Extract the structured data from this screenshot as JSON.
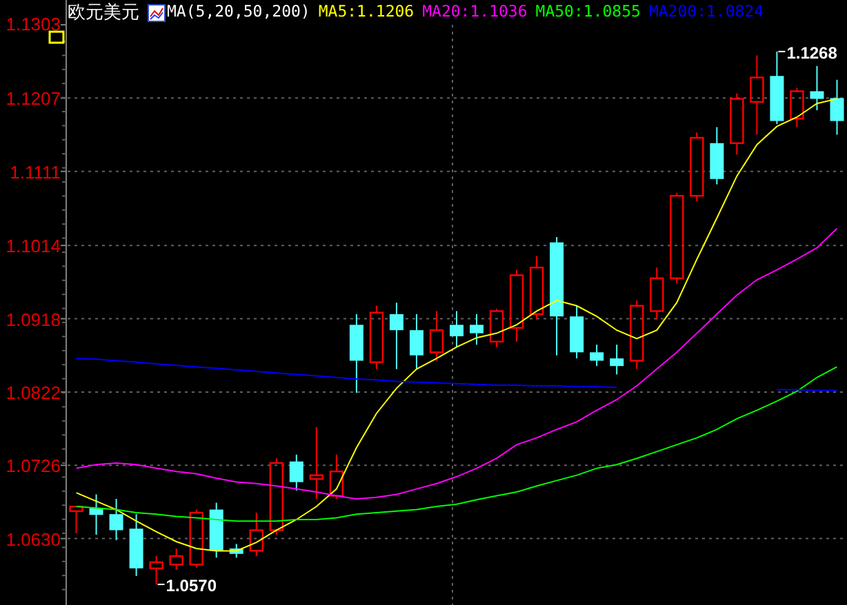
{
  "header": {
    "title": "欧元美元",
    "indicator": "MA(5,20,50,200)",
    "readings": [
      {
        "value": ":1.1206",
        "color": "#ffff00"
      },
      {
        "value": ":1.1036",
        "color": "#ff00ff"
      },
      {
        "value": ":1.0855",
        "color": "#00ff00"
      },
      {
        "value": ":1.0824",
        "color": "#0000ff"
      }
    ]
  },
  "chart": {
    "chart_data": {
      "type": "candlestick",
      "grid": true,
      "ylim": [
        1.0543,
        1.1303
      ],
      "yticks": [
        {
          "value": 1.1303,
          "label": "1.1303"
        },
        {
          "value": 1.1207,
          "label": "1.1207"
        },
        {
          "value": 1.1111,
          "label": "1.1111"
        },
        {
          "value": 1.1014,
          "label": "1.1014"
        },
        {
          "value": 1.0918,
          "label": "1.0918"
        },
        {
          "value": 1.0822,
          "label": "1.0822"
        },
        {
          "value": 1.0726,
          "label": "1.0726"
        },
        {
          "value": 1.063,
          "label": "1.0630"
        }
      ],
      "ohlc": [
        [
          1.0666,
          1.0672,
          1.0637,
          1.0672
        ],
        [
          1.067,
          1.0688,
          1.0635,
          1.0661
        ],
        [
          1.0662,
          1.0682,
          1.0628,
          1.0641
        ],
        [
          1.0643,
          1.0662,
          1.0581,
          1.0591
        ],
        [
          1.0591,
          1.0607,
          1.057,
          1.0599
        ],
        [
          1.0596,
          1.0617,
          1.0589,
          1.0607
        ],
        [
          1.0596,
          1.0668,
          1.0592,
          1.0664
        ],
        [
          1.0668,
          1.0677,
          1.0605,
          1.0614
        ],
        [
          1.0617,
          1.0623,
          1.0605,
          1.061
        ],
        [
          1.0614,
          1.0664,
          1.0607,
          1.0641
        ],
        [
          1.0641,
          1.0735,
          1.0635,
          1.0729
        ],
        [
          1.0731,
          1.074,
          1.0693,
          1.0704
        ],
        [
          1.0708,
          1.0776,
          1.0682,
          1.0713
        ],
        [
          1.0686,
          1.074,
          1.0682,
          1.0718
        ],
        [
          1.091,
          1.0924,
          1.0821,
          1.0863
        ],
        [
          1.0861,
          1.0935,
          1.0852,
          1.0926
        ],
        [
          1.0924,
          1.0939,
          1.0852,
          1.0903
        ],
        [
          1.0903,
          1.0924,
          1.0852,
          1.087
        ],
        [
          1.0874,
          1.0928,
          1.0863,
          1.0903
        ],
        [
          1.091,
          1.0928,
          1.0881,
          1.0895
        ],
        [
          1.091,
          1.0924,
          1.0884,
          1.0899
        ],
        [
          1.0888,
          1.0931,
          1.0881,
          1.0928
        ],
        [
          1.0906,
          1.0982,
          1.0888,
          1.0975
        ],
        [
          1.0924,
          1.1,
          1.0917,
          1.0985
        ],
        [
          1.1018,
          1.1025,
          1.087,
          1.0921
        ],
        [
          1.0921,
          1.0935,
          1.0866,
          1.0874
        ],
        [
          1.0874,
          1.0884,
          1.0856,
          1.0863
        ],
        [
          1.0866,
          1.0884,
          1.0845,
          1.0856
        ],
        [
          1.0863,
          1.0942,
          1.0852,
          1.0935
        ],
        [
          1.0928,
          1.0985,
          1.0917,
          1.0971
        ],
        [
          1.0971,
          1.1083,
          1.0964,
          1.1079
        ],
        [
          1.1079,
          1.1162,
          1.1072,
          1.1155
        ],
        [
          1.1148,
          1.1169,
          1.1094,
          1.1101
        ],
        [
          1.1148,
          1.1213,
          1.1133,
          1.1206
        ],
        [
          1.1202,
          1.1263,
          1.1159,
          1.1234
        ],
        [
          1.1236,
          1.1268,
          1.1173,
          1.1177
        ],
        [
          1.118,
          1.122,
          1.1169,
          1.1216
        ],
        [
          1.1216,
          1.1249,
          1.1191,
          1.1206
        ],
        [
          1.1207,
          1.1231,
          1.1159,
          1.1177
        ]
      ],
      "series": [
        {
          "name": "MA5",
          "type": "line",
          "color": "#ffff00",
          "values": [
            1.069,
            1.0679,
            1.0668,
            1.0653,
            1.0639,
            1.0626,
            1.0617,
            1.0614,
            1.0614,
            1.0625,
            1.0641,
            1.0655,
            1.0672,
            1.0695,
            1.0749,
            1.0794,
            1.0827,
            1.0852,
            1.0866,
            1.0881,
            1.0893,
            1.0899,
            1.091,
            1.0928,
            1.0942,
            1.0935,
            1.0921,
            1.0903,
            1.0892,
            1.0903,
            1.0939,
            1.0996,
            1.105,
            1.1105,
            1.1146,
            1.117,
            1.1182,
            1.12,
            1.1206
          ]
        },
        {
          "name": "MA20",
          "type": "line",
          "color": "#ff00ff",
          "values": [
            1.0722,
            1.0727,
            1.0729,
            1.0727,
            1.0722,
            1.0718,
            1.0715,
            1.0709,
            1.0704,
            1.0702,
            1.0699,
            1.0695,
            1.0691,
            1.0686,
            1.0682,
            1.0684,
            1.0688,
            1.0695,
            1.0702,
            1.0711,
            1.0722,
            1.0735,
            1.0753,
            1.0762,
            1.0773,
            1.0783,
            1.0798,
            1.0812,
            1.083,
            1.0852,
            1.0874,
            1.0899,
            1.0924,
            1.0949,
            1.0969,
            1.0982,
            1.0996,
            1.1011,
            1.1036
          ]
        },
        {
          "name": "MA50",
          "type": "line",
          "color": "#00ff00",
          "values": [
            1.0672,
            1.067,
            1.0668,
            1.0664,
            1.0662,
            1.0659,
            1.0657,
            1.0655,
            1.0653,
            1.0653,
            1.0653,
            1.0655,
            1.0655,
            1.0657,
            1.0662,
            1.0664,
            1.0666,
            1.0668,
            1.0672,
            1.0675,
            1.0681,
            1.0686,
            1.0691,
            1.0699,
            1.0706,
            1.0713,
            1.0722,
            1.0727,
            1.0735,
            1.0744,
            1.0753,
            1.0762,
            1.0773,
            1.0787,
            1.0798,
            1.081,
            1.0823,
            1.0841,
            1.0855
          ]
        },
        {
          "name": "MA200",
          "type": "line",
          "color": "#0000ff",
          "values": [
            1.0866,
            1.0865,
            1.0863,
            1.0861,
            1.0859,
            1.0857,
            1.0855,
            1.0853,
            1.0851,
            1.0849,
            1.0847,
            1.0845,
            1.0843,
            1.0841,
            1.0839,
            1.0838,
            1.0836,
            1.0835,
            1.0834,
            1.0833,
            1.0832,
            1.0831,
            1.0831,
            1.083,
            1.083,
            1.0829,
            1.0829,
            1.0828,
            null,
            null,
            null,
            null,
            null,
            null,
            null,
            1.0825,
            1.0825,
            1.0824,
            1.0824
          ]
        }
      ],
      "annotations": [
        "1.1268",
        "1.0570"
      ]
    }
  }
}
